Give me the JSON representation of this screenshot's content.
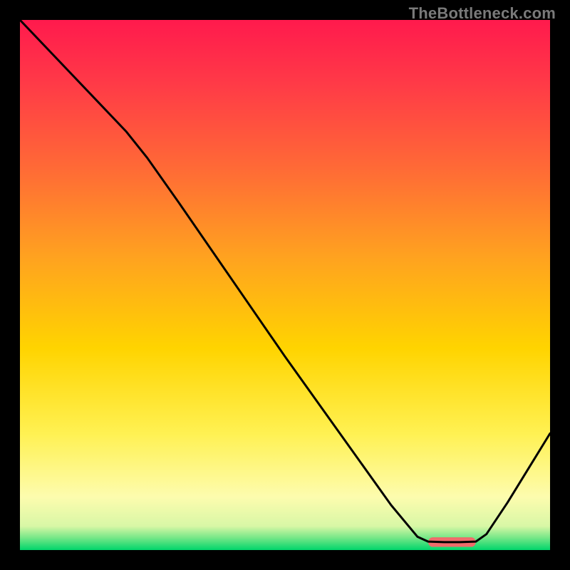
{
  "watermark": "TheBottleneck.com",
  "gradient_stops": [
    {
      "offset": 0.0,
      "color": "#ff1a4d"
    },
    {
      "offset": 0.12,
      "color": "#ff3a47"
    },
    {
      "offset": 0.28,
      "color": "#ff6a36"
    },
    {
      "offset": 0.45,
      "color": "#ffa31f"
    },
    {
      "offset": 0.62,
      "color": "#ffd400"
    },
    {
      "offset": 0.78,
      "color": "#fff152"
    },
    {
      "offset": 0.9,
      "color": "#fdfcae"
    },
    {
      "offset": 0.955,
      "color": "#d8f7a6"
    },
    {
      "offset": 0.975,
      "color": "#7fe88a"
    },
    {
      "offset": 1.0,
      "color": "#00d66b"
    }
  ],
  "highlight": {
    "color": "#ef6b6b",
    "x_start": 0.77,
    "x_end": 0.86,
    "y": 0.985,
    "thickness_frac": 0.018,
    "cap_radius_frac": 0.009
  },
  "chart_data": {
    "type": "line",
    "title": "",
    "xlabel": "",
    "ylabel": "",
    "xlim": [
      0,
      1
    ],
    "ylim": [
      0,
      1
    ],
    "note": "Axes are unlabeled; x and y are normalized 0–1 across the plot area. y=0 is bottom (green), y=1 is top (red).",
    "series": [
      {
        "name": "curve",
        "points": [
          {
            "x": 0.0,
            "y": 1.0
          },
          {
            "x": 0.1,
            "y": 0.895
          },
          {
            "x": 0.2,
            "y": 0.79
          },
          {
            "x": 0.24,
            "y": 0.74
          },
          {
            "x": 0.3,
            "y": 0.655
          },
          {
            "x": 0.4,
            "y": 0.51
          },
          {
            "x": 0.5,
            "y": 0.365
          },
          {
            "x": 0.6,
            "y": 0.225
          },
          {
            "x": 0.7,
            "y": 0.085
          },
          {
            "x": 0.75,
            "y": 0.025
          },
          {
            "x": 0.77,
            "y": 0.016
          },
          {
            "x": 0.8,
            "y": 0.015
          },
          {
            "x": 0.83,
            "y": 0.015
          },
          {
            "x": 0.86,
            "y": 0.016
          },
          {
            "x": 0.88,
            "y": 0.03
          },
          {
            "x": 0.92,
            "y": 0.09
          },
          {
            "x": 0.96,
            "y": 0.155
          },
          {
            "x": 1.0,
            "y": 0.22
          }
        ]
      }
    ]
  }
}
